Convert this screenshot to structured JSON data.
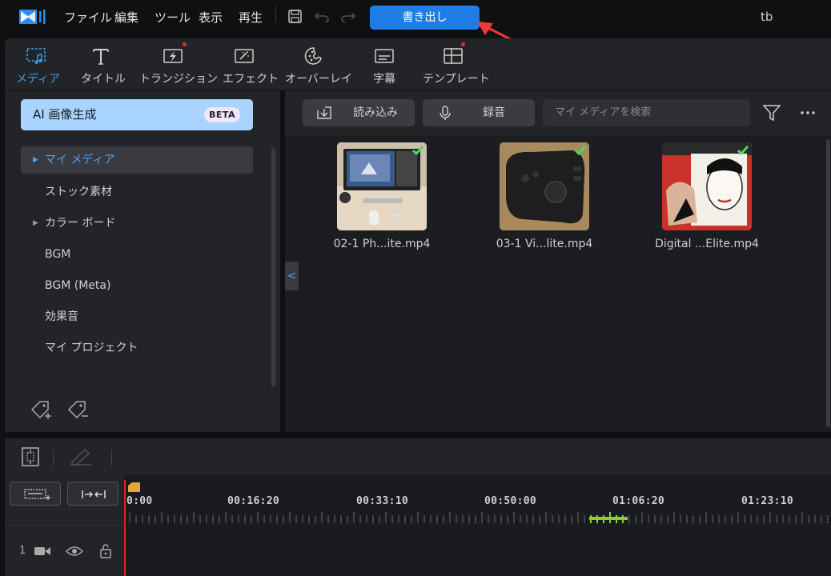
{
  "menu": [
    "ファイル",
    "編集",
    "ツール",
    "表示",
    "再生"
  ],
  "export_label": "書き出し",
  "user": "tb",
  "toolbar": [
    {
      "label": "メディア",
      "icon": "media-icon",
      "active": true
    },
    {
      "label": "タイトル",
      "icon": "title-icon"
    },
    {
      "label": "トランジション",
      "icon": "transition-icon"
    },
    {
      "label": "エフェクト",
      "icon": "effect-icon"
    },
    {
      "label": "オーバーレイ",
      "icon": "overlay-icon"
    },
    {
      "label": "字幕",
      "icon": "subtitle-icon"
    },
    {
      "label": "テンプレート",
      "icon": "template-icon"
    }
  ],
  "ai_button": {
    "label": "AI 画像生成",
    "badge": "BETA"
  },
  "sidebar": [
    {
      "label": "マイ メディア",
      "expandable": true,
      "selected": true
    },
    {
      "label": "ストック素材"
    },
    {
      "label": "カラー ボード",
      "expandable": true
    },
    {
      "label": "BGM"
    },
    {
      "label": "BGM (Meta)"
    },
    {
      "label": "効果音"
    },
    {
      "label": "マイ プロジェクト"
    }
  ],
  "media_toolbar": {
    "import_label": "読み込み",
    "record_label": "録音",
    "search_placeholder": "マイ メディアを検索"
  },
  "media_items": [
    {
      "name": "02-1 Ph...ite.mp4"
    },
    {
      "name": "03-1 Vi...lite.mp4"
    },
    {
      "name": "Digital ...Elite.mp4"
    }
  ],
  "timeline": {
    "timecodes": [
      "0:00",
      "00:16:20",
      "00:33:10",
      "00:50:00",
      "01:06:20",
      "01:23:10"
    ],
    "track_number": "1"
  },
  "colors": {
    "accent": "#1f7de6",
    "active_text": "#3d9bf0",
    "ai_button": "#a9d4ff",
    "check": "#4cd964",
    "playhead": "#e02020",
    "highlight_ticks": "#8cd12a"
  }
}
